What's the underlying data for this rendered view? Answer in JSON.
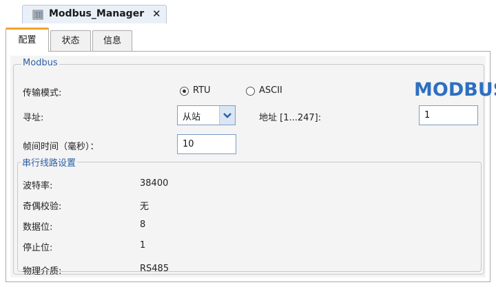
{
  "document_tab": {
    "title": "Modbus_Manager",
    "close_glyph": "✕",
    "icon": "module-icon"
  },
  "tabs": [
    {
      "label": "配置",
      "active": true
    },
    {
      "label": "状态",
      "active": false
    },
    {
      "label": "信息",
      "active": false
    }
  ],
  "modbus_group": {
    "title": "Modbus",
    "logo_text": "MODBUS",
    "transmission": {
      "label": "传输模式:",
      "options": [
        "RTU",
        "ASCII"
      ],
      "selected": "RTU"
    },
    "addressing": {
      "label": "寻址:",
      "selected": "从站",
      "address_label": "地址 [1...247]:",
      "address_value": "1"
    },
    "frame_time": {
      "label": "帧间时间（毫秒）：",
      "value": "10"
    }
  },
  "serial_group": {
    "title": "串行线路设置",
    "rows": [
      {
        "label": "波特率:",
        "value": "38400"
      },
      {
        "label": "奇偶校验:",
        "value": "无"
      },
      {
        "label": "数据位:",
        "value": "8"
      },
      {
        "label": "停止位:",
        "value": "1"
      },
      {
        "label": "物理介质:",
        "value": "RS485"
      }
    ]
  },
  "colors": {
    "accent_tab": "#f2a32a",
    "group_title": "#2a5fa8",
    "logo": "#2d6fc0"
  }
}
